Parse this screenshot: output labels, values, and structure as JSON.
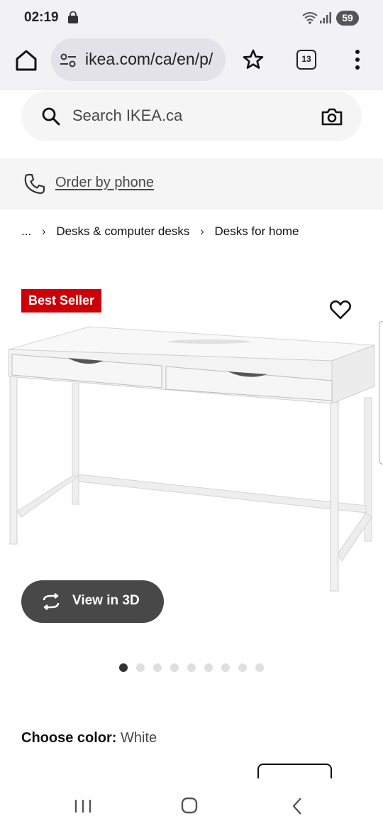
{
  "status_bar": {
    "time": "02:19",
    "battery": "59",
    "icons": [
      "shopping-bag-icon",
      "wifi-icon",
      "signal-icon",
      "battery-icon"
    ]
  },
  "browser": {
    "url": "ikea.com/ca/en/p/",
    "tab_count": "13",
    "icons": [
      "home-icon",
      "site-settings-icon",
      "star-icon",
      "tabs-icon",
      "more-vert-icon"
    ]
  },
  "search": {
    "placeholder": "Search IKEA.ca",
    "icons": [
      "search-icon",
      "camera-icon"
    ]
  },
  "order_by_phone": {
    "label": "Order by phone",
    "icon": "phone-icon"
  },
  "breadcrumb": {
    "items": [
      "...",
      "Desks & computer desks",
      "Desks for home"
    ]
  },
  "product": {
    "badge": "Best Seller",
    "favorite_icon": "heart-icon",
    "view_3d_label": "View in 3D",
    "image_count": 9,
    "active_image_index": 0,
    "color_label": "Choose color:",
    "color_value": "White"
  },
  "colors": {
    "badge_red": "#cc0008",
    "button_dark": "#484848",
    "bar_bg": "#f2f2f5",
    "panel_bg": "#f5f5f5"
  },
  "nav_bar": {
    "icons": [
      "recent-apps-icon",
      "home-button-icon",
      "back-icon"
    ]
  }
}
